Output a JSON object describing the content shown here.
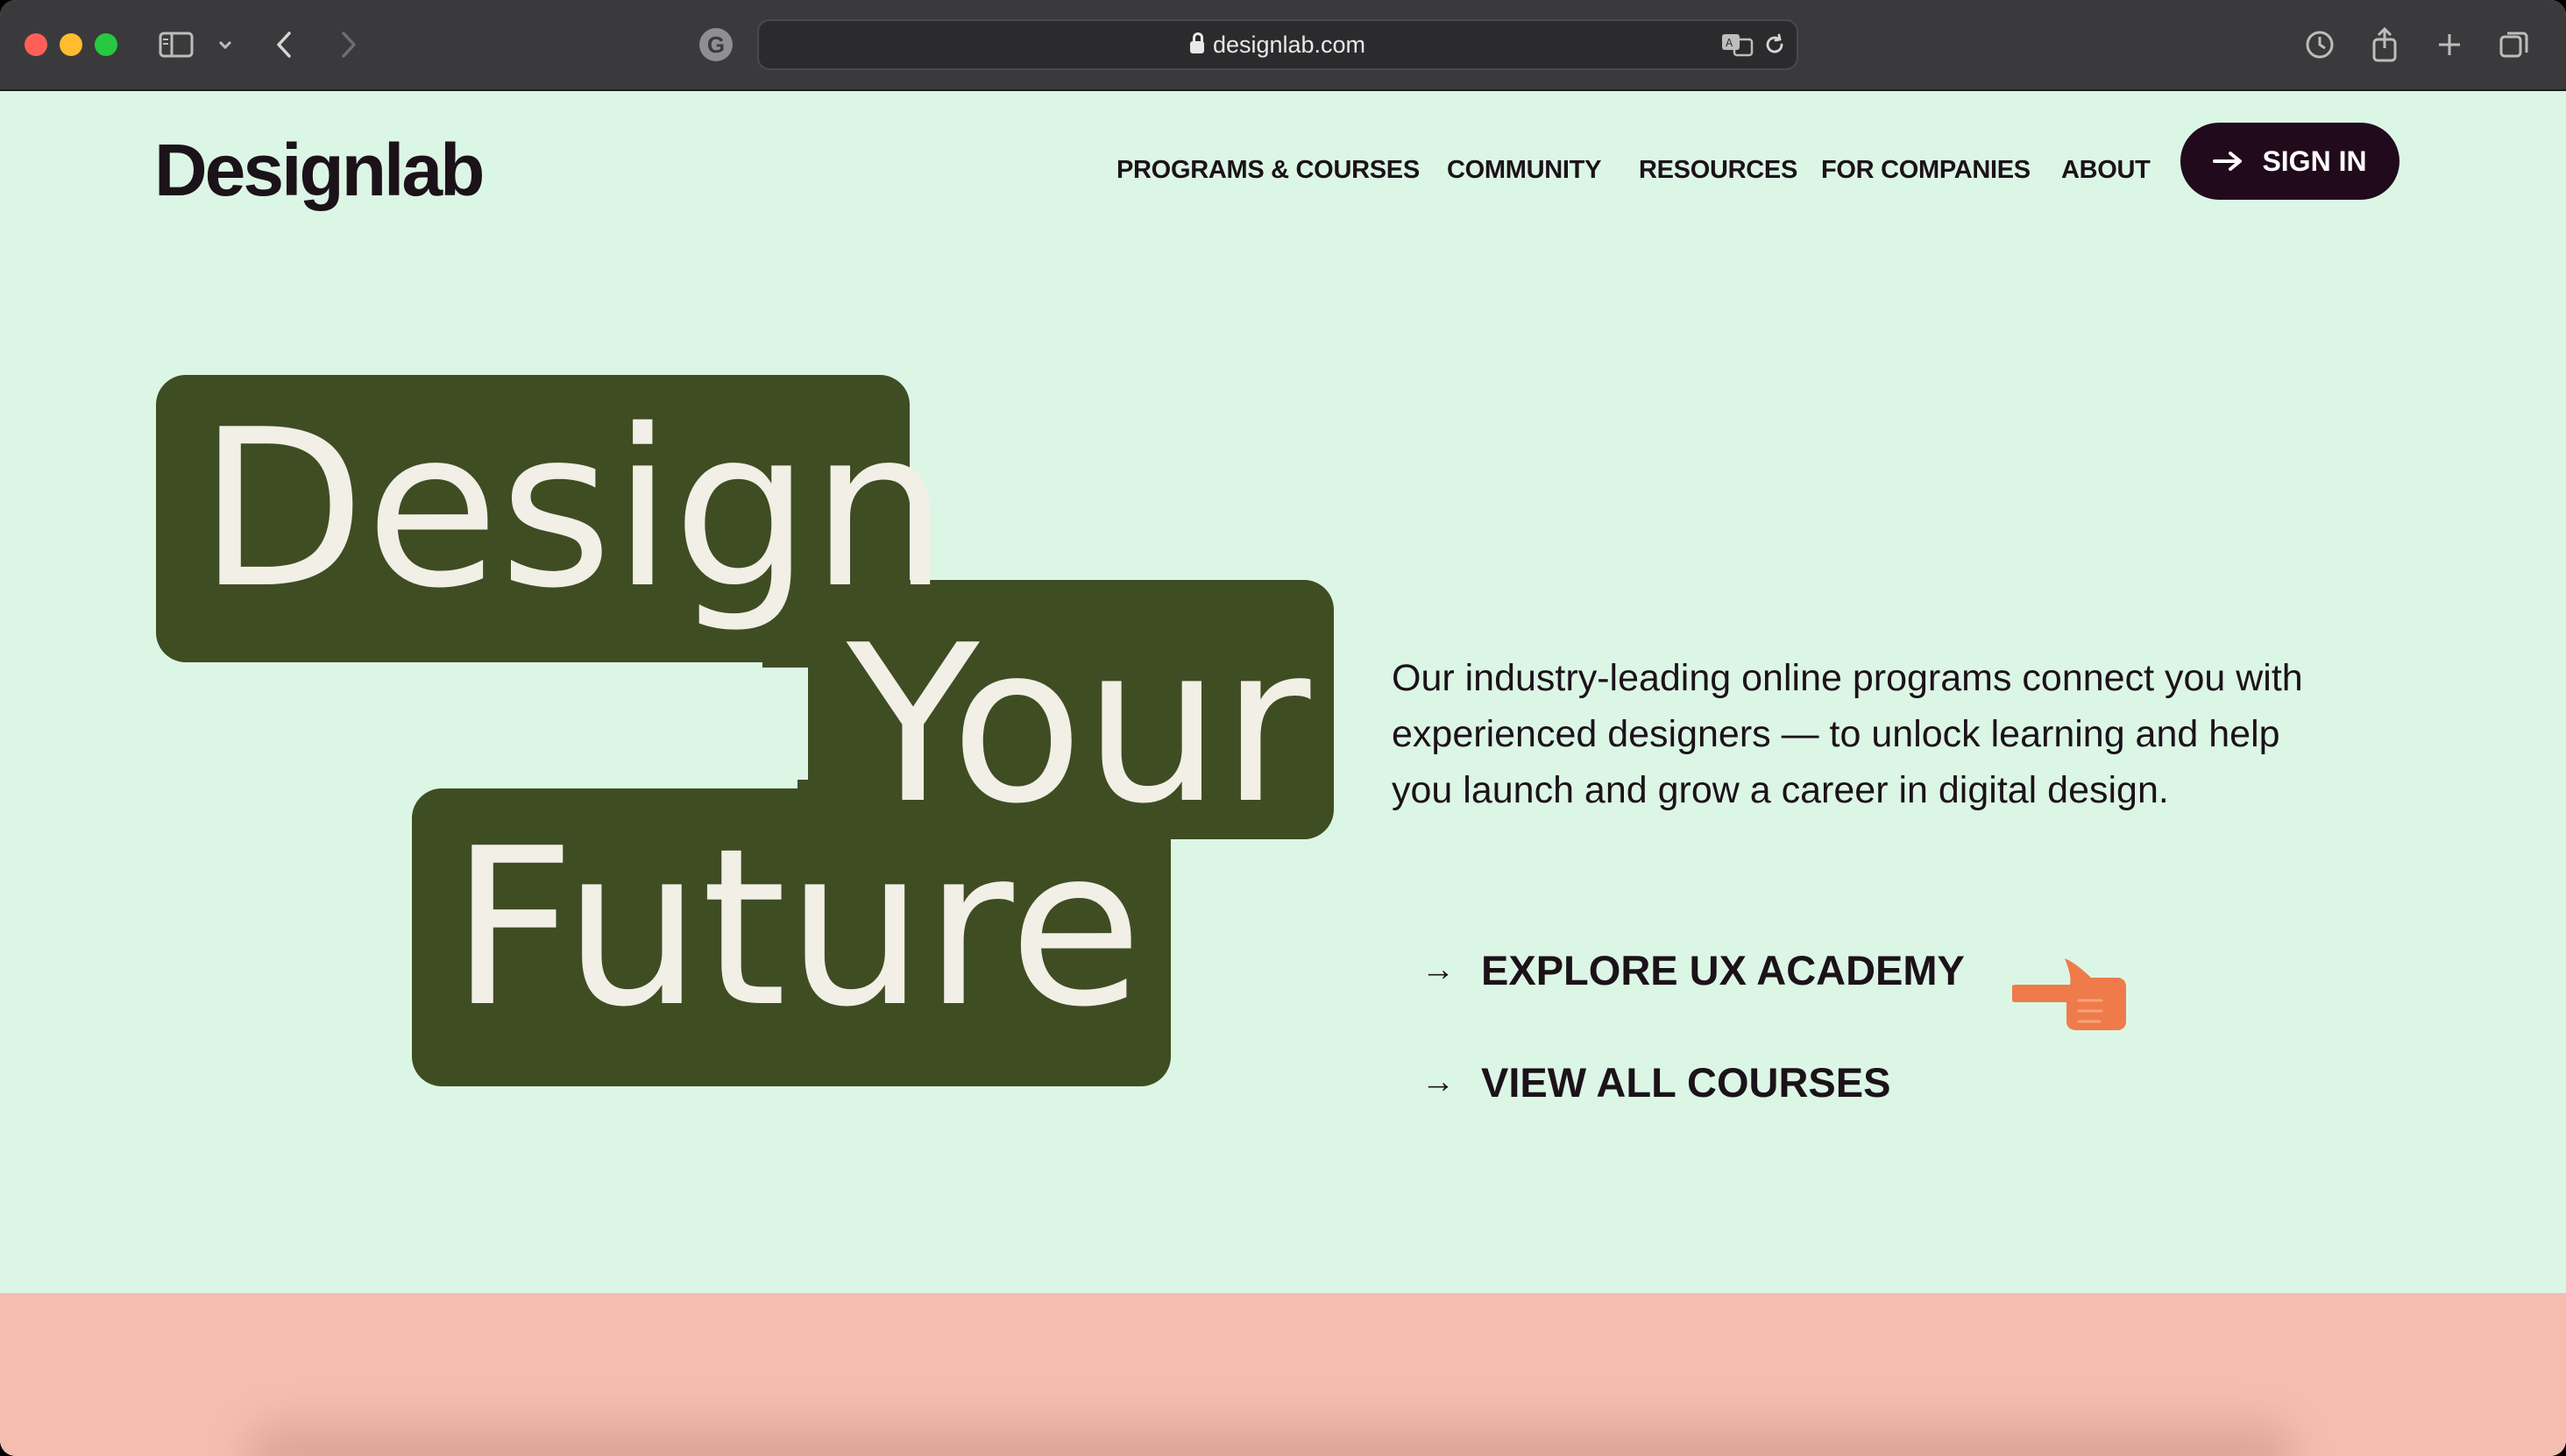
{
  "browser": {
    "url": "designlab.com",
    "search_engine_badge": "G",
    "icons": [
      "sidebar-icon",
      "chevron-down-icon",
      "back-icon",
      "forward-icon",
      "translate-icon",
      "reload-icon",
      "history-icon",
      "share-icon",
      "new-tab-icon",
      "tabs-overview-icon"
    ]
  },
  "site": {
    "logo": "Designlab",
    "nav": [
      "PROGRAMS & COURSES",
      "COMMUNITY",
      "RESOURCES",
      "FOR COMPANIES",
      "ABOUT"
    ],
    "sign_in": "SIGN IN",
    "colors": {
      "background": "#dcf6e6",
      "hero_block": "#3f4d23",
      "hero_text": "#f1efe6",
      "button": "#200a1c",
      "band": "#f5bdb0",
      "hand": "#ef7b4a"
    }
  },
  "hero": {
    "word1": "Design",
    "word2": "Your",
    "word3": "Future",
    "intro": "Our industry-leading online programs connect you with experienced designers — to unlock learning and help you launch and grow a career in digital design.",
    "cta_primary": "EXPLORE UX ACADEMY",
    "cta_secondary": "VIEW ALL COURSES",
    "arrow": "→"
  }
}
